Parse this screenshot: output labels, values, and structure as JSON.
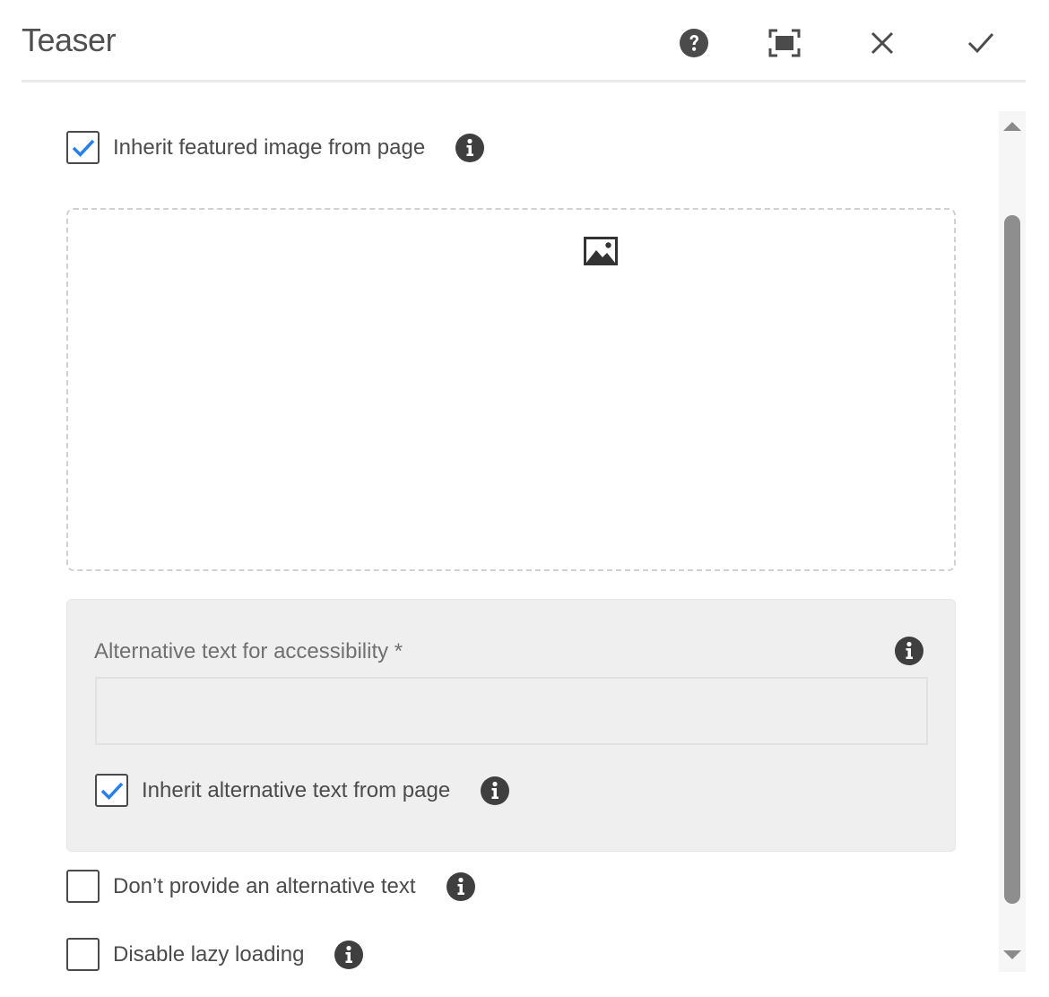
{
  "dialog": {
    "title": "Teaser",
    "toolbar": {
      "help_icon": "help-icon",
      "fullscreen_icon": "fullscreen-icon",
      "close_icon": "close-icon",
      "done_icon": "checkmark-icon"
    }
  },
  "image": {
    "inherit_featured_label": "Inherit featured image from page",
    "inherit_featured_checked": true,
    "dropzone_icon": "image-icon"
  },
  "alt_text": {
    "label": "Alternative text for accessibility *",
    "value": "",
    "inherit_label": "Inherit alternative text from page",
    "inherit_checked": true
  },
  "options": {
    "no_alt_label": "Don’t provide an alternative text",
    "no_alt_checked": false,
    "lazy_label": "Disable lazy loading",
    "lazy_checked": false
  },
  "colors": {
    "accent": "#2680eb",
    "icon": "#4b4b4b",
    "panel_bg": "#efefef"
  }
}
